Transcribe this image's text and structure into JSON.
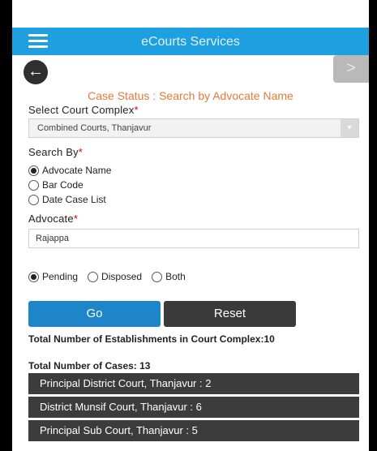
{
  "app": {
    "title": "eCourts Services"
  },
  "nav": {
    "back_glyph": "←",
    "next_glyph": ">"
  },
  "form": {
    "heading": "Case Status : Search by Advocate Name",
    "court_complex_label": "Select Court Complex",
    "court_complex_value": "Combined Courts, Thanjavur",
    "search_by_label": "Search By",
    "search_by_options": [
      "Advocate Name",
      "Bar Code",
      "Date Case List"
    ],
    "search_by_selected": "Advocate Name",
    "advocate_label": "Advocate",
    "advocate_value": "Rajappa",
    "required_mark": "*",
    "status_options": [
      "Pending",
      "Disposed",
      "Both"
    ],
    "status_selected": "Pending",
    "go_label": "Go",
    "reset_label": "Reset"
  },
  "results": {
    "establishments_text": "Total Number of Establishments in Court Complex:10",
    "cases_text": "Total Number of Cases: 13",
    "courts": [
      "Principal District Court, Thanjavur : 2",
      "District Munsif Court, Thanjavur : 6",
      "Principal Sub Court, Thanjavur : 5"
    ]
  },
  "colors": {
    "app_bar": "#1e9fe0",
    "heading": "#e47a3a",
    "go_button": "#1e86c8",
    "court_row": "#3c3c3c"
  },
  "icons": {
    "menu": "hamburger-icon",
    "back": "back-arrow-icon",
    "next": "chevron-right-icon",
    "dropdown": "chevron-down-icon"
  }
}
